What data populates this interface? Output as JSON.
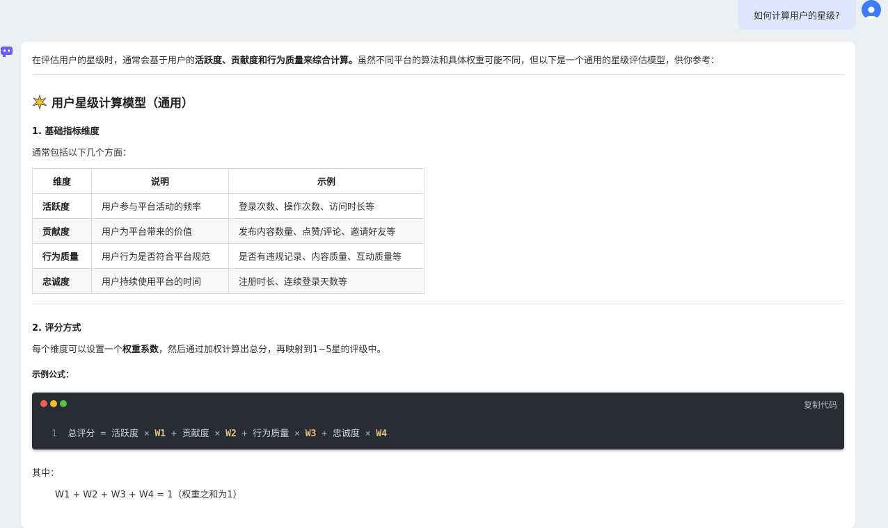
{
  "user_message": "如何计算用户的星级?",
  "intro": {
    "before": "在评估用户的星级时，通常会基于用户的",
    "bold": "活跃度、贡献度和行为质量",
    "bold_after": "来综合计算。",
    "after": "虽然不同平台的算法和具体权重可能不同，但以下是一个通用的星级评估模型，供你参考："
  },
  "heading": "用户星级计算模型（通用）",
  "section1": {
    "title": "1. 基础指标维度",
    "desc": "通常包括以下几个方面：",
    "table": {
      "headers": [
        "维度",
        "说明",
        "示例"
      ],
      "rows": [
        [
          "活跃度",
          "用户参与平台活动的频率",
          "登录次数、操作次数、访问时长等"
        ],
        [
          "贡献度",
          "用户为平台带来的价值",
          "发布内容数量、点赞/评论、邀请好友等"
        ],
        [
          "行为质量",
          "用户行为是否符合平台规范",
          "是否有违规记录、内容质量、互动质量等"
        ],
        [
          "忠诚度",
          "用户持续使用平台的时间",
          "注册时长、连续登录天数等"
        ]
      ]
    }
  },
  "section2": {
    "title": "2. 评分方式",
    "desc_before": "每个维度可以设置一个",
    "desc_bold": "权重系数",
    "desc_after": "，然后通过加权计算出总分，再映射到1~5星的评级中。",
    "formula_label": "示例公式："
  },
  "code": {
    "copy_label": "复制代码",
    "line_no": "1",
    "tokens": [
      "总评分",
      "=",
      "活跃度",
      "×",
      "W1",
      "+",
      "贡献度",
      "×",
      "W2",
      "+",
      "行为质量",
      "×",
      "W3",
      "+",
      "忠诚度",
      "×",
      "W4"
    ]
  },
  "where_label": "其中：",
  "weight_note": "W1 + W2 + W3 + W4 = 1（权重之和为1）",
  "colors": {
    "accent": "#3d7df5",
    "code_bg": "#282c34",
    "code_keyword": "#e5c07b",
    "user_bubble": "#dde6fb"
  }
}
